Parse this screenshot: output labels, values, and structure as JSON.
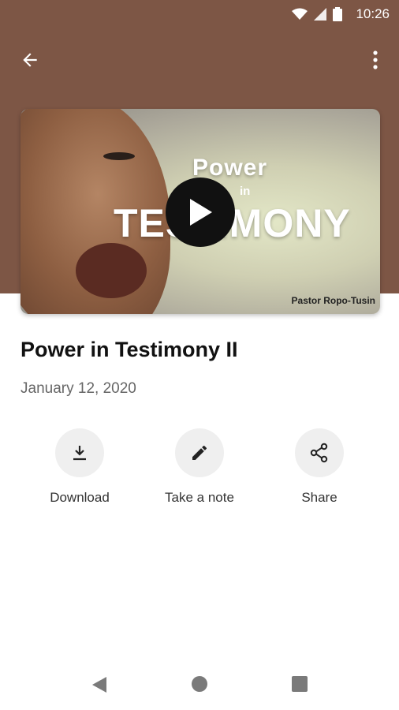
{
  "status_bar": {
    "time": "10:26",
    "icons": [
      "wifi-icon",
      "signal-icon",
      "battery-icon"
    ]
  },
  "app_bar": {
    "back_icon": "arrow-left-icon",
    "menu_icon": "more-vert-icon"
  },
  "video": {
    "thumbnail_title_line1": "Power",
    "thumbnail_title_line2": "in",
    "thumbnail_title_line3": "TESTIMONY",
    "thumbnail_author": "Pastor Ropo-Tusin",
    "play_icon": "play-icon"
  },
  "sermon": {
    "title": "Power in Testimony II",
    "date": "January 12, 2020"
  },
  "actions": [
    {
      "label": "Download",
      "icon": "download-icon"
    },
    {
      "label": "Take a note",
      "icon": "pencil-icon"
    },
    {
      "label": "Share",
      "icon": "share-icon"
    }
  ],
  "nav_bar": {
    "icons": [
      "back-triangle-icon",
      "home-circle-icon",
      "recents-square-icon"
    ]
  },
  "colors": {
    "header": "#7d5645",
    "action_bg": "#efefef",
    "play_button": "#111111"
  }
}
